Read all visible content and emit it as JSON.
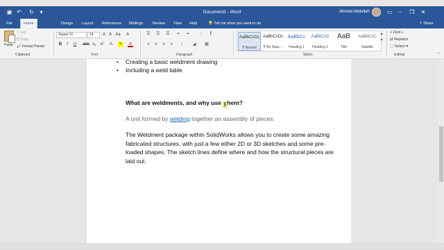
{
  "window": {
    "title": "Document1 - Word",
    "user": "Ahmed Abdullah",
    "controls": [
      "minimize",
      "restore",
      "close"
    ]
  },
  "tabs": [
    "File",
    "Home",
    "Design",
    "Layout",
    "References",
    "Mailings",
    "Review",
    "View",
    "Help"
  ],
  "active_tab": "Home",
  "tell_me": "Tell me what you want to do",
  "share": "Share",
  "clipboard": {
    "paste": "Paste",
    "cut": "Cut",
    "copy": "Copy",
    "format_painter": "Format Painter",
    "label": "Clipboard"
  },
  "font": {
    "name": "Segoe UI",
    "size": "14",
    "label": "Font",
    "buttons": [
      "B",
      "I",
      "U",
      "abc",
      "x₂",
      "x²"
    ]
  },
  "paragraph": {
    "label": "Paragraph"
  },
  "styles": {
    "label": "Styles",
    "items": [
      {
        "sample": "AaBbCcDc",
        "name": "¶ Normal"
      },
      {
        "sample": "AaBbCcDc",
        "name": "¶ No Spac..."
      },
      {
        "sample": "AaBbCc",
        "name": "Heading 1"
      },
      {
        "sample": "AaBbCcC",
        "name": "Heading 2"
      },
      {
        "sample": "AaB",
        "name": "Title"
      },
      {
        "sample": "AaBbCcC",
        "name": "Subtitle"
      }
    ]
  },
  "editing": {
    "label": "Editing",
    "find": "Find",
    "replace": "Replace",
    "select": "Select"
  },
  "document": {
    "bullets": [
      "Creating a basic weldment drawing",
      "Including a weld table"
    ],
    "heading_before": "What are weldments, and why use ",
    "heading_cursor": "I",
    "heading_after": "hem?",
    "definition_prefix": "A unit formed by ",
    "definition_link": "welding",
    "definition_suffix": " together an assembly of pieces.",
    "paragraph": "The Weldment package within SolidWorks allows you to create some amazing fabricated structures, with just a few either 2D or 3D sketches and some pre-loaded shapes. The sketch lines define where and how the structural pieces are laid out."
  },
  "colors": {
    "titlebar": "#2b579a",
    "link": "#1f5fa9",
    "highlight": "#f1e08a"
  }
}
